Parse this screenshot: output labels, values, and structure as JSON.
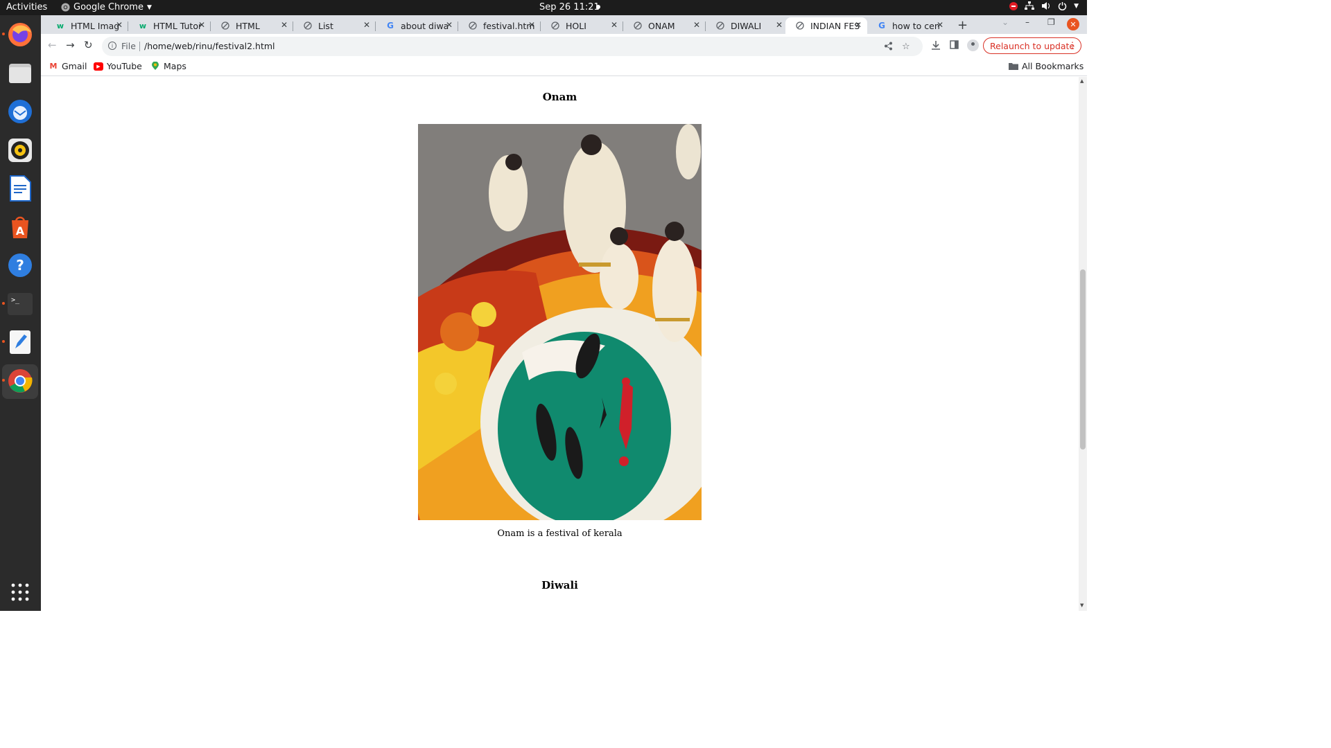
{
  "system": {
    "activities": "Activities",
    "app_name": "Google Chrome",
    "datetime": "Sep 26  11:21"
  },
  "browser": {
    "tabs": [
      {
        "title": "HTML Imag",
        "icon": "w3schools-icon"
      },
      {
        "title": "HTML Tutor",
        "icon": "w3schools-icon"
      },
      {
        "title": "HTML",
        "icon": "globe-icon"
      },
      {
        "title": "List",
        "icon": "globe-icon"
      },
      {
        "title": "about diwa",
        "icon": "google-icon"
      },
      {
        "title": "festival.htm",
        "icon": "globe-icon"
      },
      {
        "title": "HOLI",
        "icon": "globe-icon"
      },
      {
        "title": "ONAM",
        "icon": "globe-icon"
      },
      {
        "title": "DIWALI",
        "icon": "globe-icon"
      },
      {
        "title": "INDIAN FES",
        "icon": "globe-icon",
        "active": true
      },
      {
        "title": "how to cen",
        "icon": "google-icon"
      }
    ],
    "new_tab": "+",
    "address": {
      "scheme_label": "File",
      "url": "/home/web/rinu/festival2.html"
    },
    "relaunch_label": "Relaunch to update",
    "bookmarks": [
      {
        "label": "Gmail"
      },
      {
        "label": "YouTube"
      },
      {
        "label": "Maps"
      }
    ],
    "all_bookmarks": "All Bookmarks"
  },
  "page": {
    "sections": [
      {
        "heading": "Onam",
        "caption": "Onam is a festival of kerala"
      },
      {
        "heading": "Diwali"
      }
    ]
  },
  "colors": {
    "accent_ubuntu": "#e95420",
    "relaunch_red": "#d93025"
  }
}
